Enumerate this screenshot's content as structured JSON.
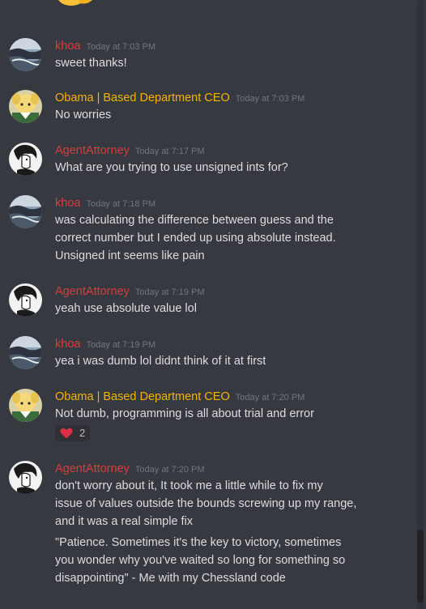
{
  "messages": [
    {
      "author": "khoa",
      "time": "Today at 7:03 PM",
      "lines": [
        "sweet thanks!"
      ]
    },
    {
      "author": "Obama | Based Department CEO",
      "time": "Today at 7:03 PM",
      "lines": [
        "No worries"
      ]
    },
    {
      "author": "AgentAttorney",
      "time": "Today at 7:17 PM",
      "lines": [
        "What are you trying to use unsigned ints for?"
      ]
    },
    {
      "author": "khoa",
      "time": "Today at 7:18 PM",
      "lines": [
        "was calculating the difference between guess and the",
        "correct number but I ended up using absolute instead.",
        "Unsigned int seems like pain"
      ]
    },
    {
      "author": "AgentAttorney",
      "time": "Today at 7:19 PM",
      "lines": [
        "yeah use absolute value lol"
      ]
    },
    {
      "author": "khoa",
      "time": "Today at 7:19 PM",
      "lines": [
        "yea i was dumb lol didnt think of it at first"
      ]
    },
    {
      "author": "Obama | Based Department CEO",
      "time": "Today at 7:20 PM",
      "lines": [
        "Not dumb, programming is all about trial and error"
      ],
      "reaction": {
        "emoji": "heart-icon",
        "count": "2"
      }
    },
    {
      "author": "AgentAttorney",
      "time": "Today at 7:20 PM",
      "lines": [
        "don't worry about it, It took me a little while to fix my",
        "issue of values outside the bounds screwing up my range,",
        "and it was a real simple fix"
      ],
      "lines2": [
        "\"Patience. Sometimes it's the key to victory, sometimes",
        "you wonder why you've waited so long for something so",
        "disappointing\" - Me with my Chessland code"
      ]
    }
  ],
  "colors": {
    "background": "#36393f",
    "text": "#dcddde",
    "timestamp": "#72767d",
    "khoa": "#e03b3b",
    "obama": "#f5b400",
    "agent": "#d83c3e"
  }
}
